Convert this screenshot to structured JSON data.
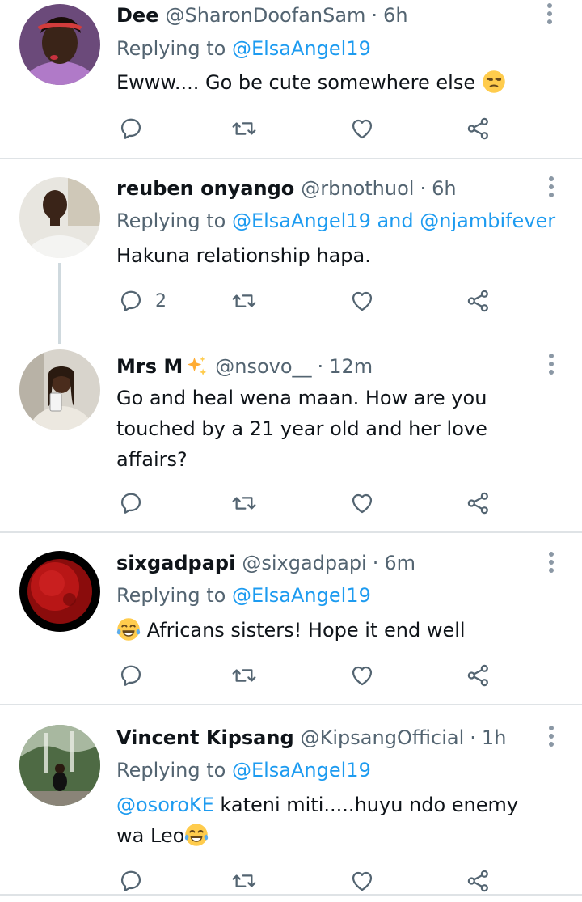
{
  "tweets": [
    {
      "name": "Dee",
      "handle": "@SharonDoofanSam",
      "time": "6h",
      "replying_prefix": "Replying to",
      "replying_to": "@ElsaAngel19",
      "text": "Ewww.... Go be cute somewhere else",
      "emoji": "unamused-face",
      "reply_count": ""
    },
    {
      "name": "reuben onyango",
      "handle": "@rbnothuol",
      "time": "6h",
      "replying_prefix": "Replying to",
      "replying_to": "@ElsaAngel19 and @njambifever",
      "text": "Hakuna relationship hapa.",
      "reply_count": "2"
    },
    {
      "name": "Mrs M",
      "name_emoji": "sparkles",
      "handle": "@nsovo__",
      "time": "12m",
      "text_line1": "Go and heal wena maan. How are you",
      "text_line2": "touched by a 21 year old and her love",
      "text_line3": "affairs?",
      "reply_count": ""
    },
    {
      "name": "sixgadpapi",
      "handle": "@sixgadpapi",
      "time": "6m",
      "replying_prefix": "Replying to",
      "replying_to": "@ElsaAngel19",
      "emoji": "face-with-tears-of-joy",
      "text": "Africans sisters! Hope it end well",
      "reply_count": ""
    },
    {
      "name": "Vincent Kipsang",
      "handle": "@KipsangOfficial",
      "time": "1h",
      "replying_prefix": "Replying to",
      "replying_to": "@ElsaAngel19",
      "mention": "@osoroKE",
      "text_line1": " kateni miti.....huyu ndo enemy",
      "text_line2": "wa Leo",
      "emoji": "face-with-tears-of-joy",
      "reply_count": ""
    }
  ],
  "separator": "·",
  "icons": {
    "reply": "reply-icon",
    "retweet": "retweet-icon",
    "like": "heart-icon",
    "share": "share-icon",
    "more": "more-options-icon"
  },
  "colors": {
    "link": "#1d9bf0",
    "secondary_text": "#536471",
    "icon": "#536471",
    "divider": "#dfe3e6"
  }
}
